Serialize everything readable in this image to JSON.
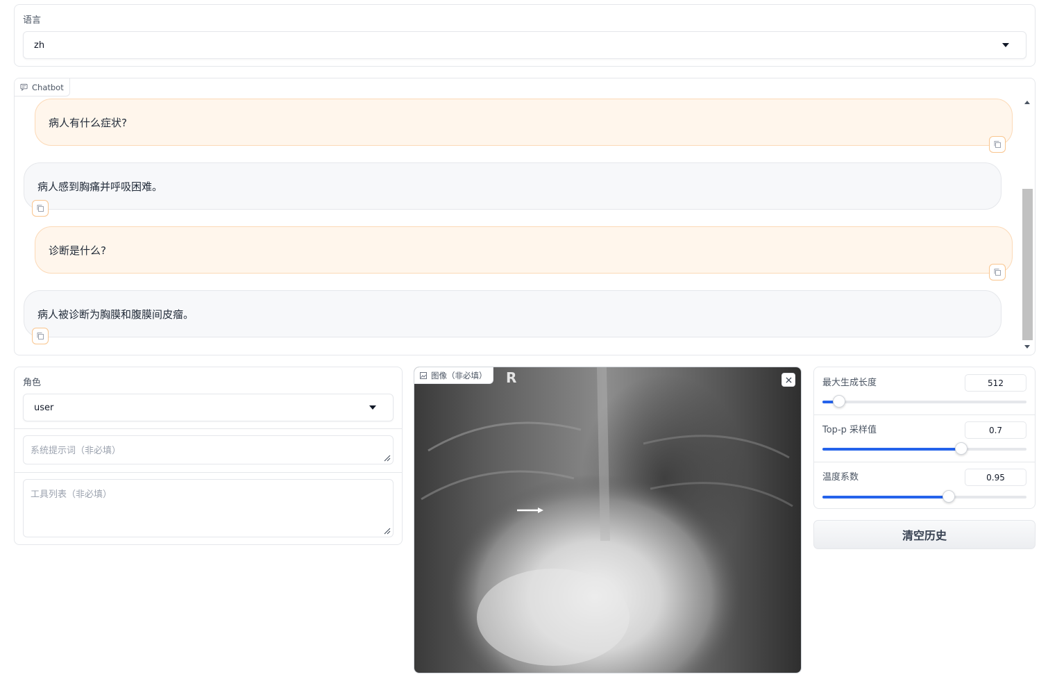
{
  "language": {
    "label": "语言",
    "value": "zh"
  },
  "chatbot": {
    "label": "Chatbot",
    "messages": [
      {
        "role": "user",
        "text": "病人有什么症状?"
      },
      {
        "role": "assistant",
        "text": "病人感到胸痛并呼吸困难。"
      },
      {
        "role": "user",
        "text": "诊断是什么?"
      },
      {
        "role": "assistant",
        "text": "病人被诊断为胸膜和腹膜间皮瘤。"
      }
    ]
  },
  "role": {
    "label": "角色",
    "value": "user"
  },
  "system_prompt": {
    "placeholder": "系统提示词（非必填）"
  },
  "tools": {
    "placeholder": "工具列表（非必填）"
  },
  "image": {
    "label": "图像（非必填）",
    "marker": "R",
    "description": "chest x-ray"
  },
  "params": {
    "max_length": {
      "label": "最大生成长度",
      "value": "512",
      "fraction": 0.08
    },
    "top_p": {
      "label": "Top-p 采样值",
      "value": "0.7",
      "fraction": 0.68
    },
    "temperature": {
      "label": "温度系数",
      "value": "0.95",
      "fraction": 0.62
    }
  },
  "clear_button": {
    "label": "清空历史"
  },
  "colors": {
    "accent": "#2563eb",
    "user_bubble": "#fff6ec",
    "user_border": "#fcd9b6",
    "bot_bubble": "#f7f8fa"
  }
}
